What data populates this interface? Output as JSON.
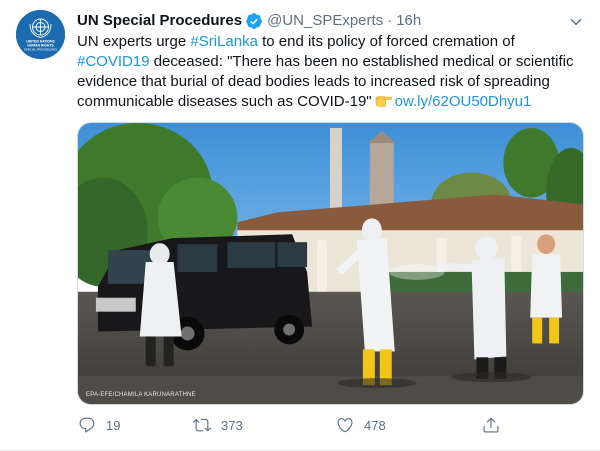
{
  "tweet": {
    "display_name": "UN Special Procedures",
    "handle": "@UN_SPExperts",
    "separator": "·",
    "time": "16h",
    "verified": true,
    "avatar_text": [
      "UNITED NATIONS",
      "HUMAN RIGHTS",
      "SPECIAL PROCEDURES"
    ],
    "text": {
      "l1_a": "UN experts urge ",
      "l1_hashtag": "#SriLanka",
      "l1_b": " to end its policy of forced cremation of",
      "l2_hashtag": "#COVID19",
      "l2_b": " deceased: \"There has been no established medical or scientific",
      "l3": "evidence that burial of dead bodies leads to increased risk of spreading",
      "l4_a": "communicable diseases such as COVID-19\"",
      "l4_link": "ow.ly/62OU50Dhyu1"
    },
    "emoji": "backhand-index-pointing-right",
    "media": {
      "alt": "Health workers in protective suits next to a black van",
      "credit": "EPA-EFE/CHAMILA KARUNARATHNE"
    },
    "actions": {
      "reply_count": "19",
      "retweet_count": "373",
      "like_count": "478"
    }
  },
  "colors": {
    "link": "#1b95e0",
    "secondary_text": "#5b7083",
    "verified": "#1da1f2",
    "avatar_bg": "#1c6bb0"
  }
}
